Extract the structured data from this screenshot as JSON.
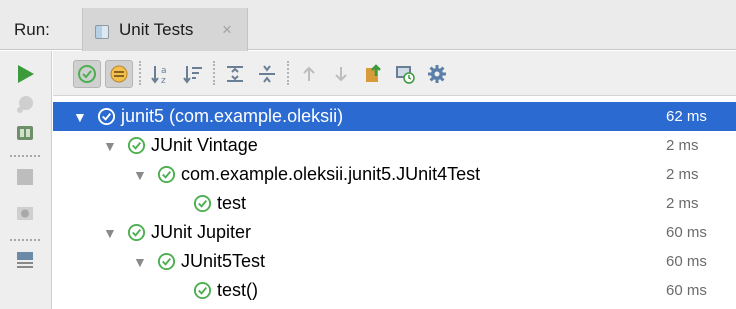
{
  "runbar": {
    "run_label": "Run:",
    "tab_label": "Unit Tests",
    "tab_close": "×"
  },
  "tree": {
    "rows": [
      {
        "label": "junit5 (com.example.oleksii)",
        "time": "62 ms",
        "selected": true,
        "status": "passed"
      },
      {
        "label": "JUnit Vintage",
        "time": "2 ms",
        "status": "passed"
      },
      {
        "label": "com.example.oleksii.junit5.JUnit4Test",
        "time": "2 ms",
        "status": "passed"
      },
      {
        "label": "test",
        "time": "2 ms",
        "status": "passed"
      },
      {
        "label": "JUnit Jupiter",
        "time": "60 ms",
        "status": "passed"
      },
      {
        "label": "JUnit5Test",
        "time": "60 ms",
        "status": "passed"
      },
      {
        "label": "test()",
        "time": "60 ms",
        "status": "passed"
      }
    ]
  },
  "colors": {
    "selection": "#2a6ad1",
    "passed": "#4caf50",
    "run": "#3b9a3b"
  }
}
